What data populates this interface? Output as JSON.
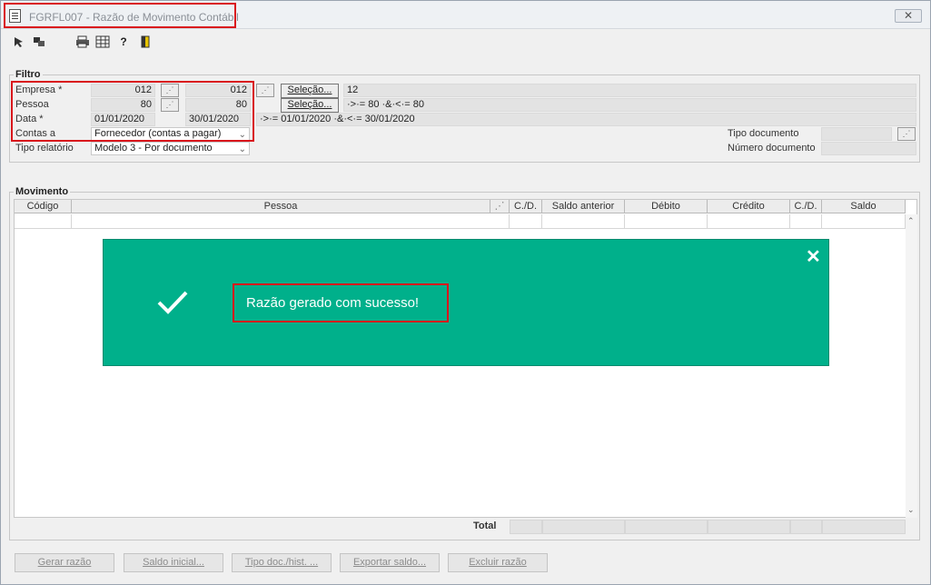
{
  "window": {
    "title": "FGRFL007 - Razão de Movimento Contábil",
    "close_label": "✕"
  },
  "toolbar": [
    "arrow-select-icon",
    "transfer-icon",
    "printer-icon",
    "grid-icon",
    "help-icon",
    "exit-door-icon"
  ],
  "filtro": {
    "legend": "Filtro",
    "empresa": {
      "label": "Empresa *",
      "from": "012",
      "to": "012",
      "sel_label": "Seleção...",
      "summary": "12"
    },
    "pessoa": {
      "label": "Pessoa",
      "from": "80",
      "to": "80",
      "sel_label": "Seleção...",
      "summary": "·>·= 80 ·&·<·= 80"
    },
    "data": {
      "label": "Data *",
      "from": "01/01/2020",
      "to": "30/01/2020",
      "summary": "·>·= 01/01/2020 ·&·<·= 30/01/2020"
    },
    "contas": {
      "label": "Contas a",
      "value": "Fornecedor (contas a pagar)"
    },
    "tipo_relatorio": {
      "label": "Tipo relatório",
      "value": "Modelo 3 - Por documento"
    },
    "tipo_documento": {
      "label": "Tipo documento",
      "value": ""
    },
    "numero_documento": {
      "label": "Número documento",
      "value": ""
    }
  },
  "movimento": {
    "legend": "Movimento",
    "columns": [
      "Código",
      "Pessoa",
      "",
      "C./D.",
      "Saldo anterior",
      "Débito",
      "Crédito",
      "C./D.",
      "Saldo"
    ],
    "total_label": "Total"
  },
  "toast": {
    "message": "Razão gerado com sucesso!",
    "close": "✕",
    "color": "#00b08b"
  },
  "buttons": {
    "gerar": "Gerar razão",
    "saldo": "Saldo inicial...",
    "tipo": "Tipo doc./hist. ...",
    "exportar": "Exportar saldo...",
    "excluir": "Excluir razão"
  }
}
